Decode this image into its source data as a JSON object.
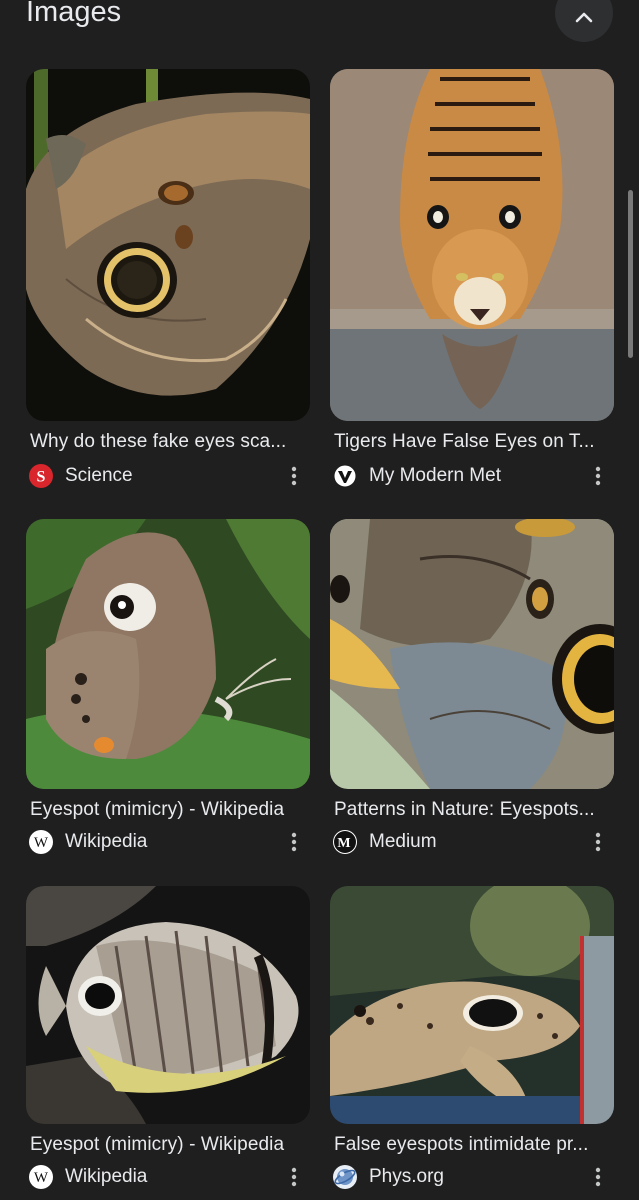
{
  "section": {
    "title": "Images",
    "collapse_icon": "chevron-up-icon"
  },
  "results": [
    {
      "title": "Why do these fake eyes sca...",
      "source": "Science",
      "favicon": "science-logo-icon",
      "image": "owl butterfly eyespot wing"
    },
    {
      "title": "Tigers Have False Eyes on T...",
      "source": "My Modern Met",
      "favicon": "my-modern-met-logo-icon",
      "image": "tiger drinking water"
    },
    {
      "title": "Eyespot (mimicry) - Wikipedia",
      "source": "Wikipedia",
      "favicon": "wikipedia-logo-icon",
      "image": "brown butterfly on leaf"
    },
    {
      "title": "Patterns in Nature: Eyespots...",
      "source": "Medium",
      "favicon": "medium-logo-icon",
      "image": "butterfly wing eyespot closeup"
    },
    {
      "title": "Eyespot (mimicry) - Wikipedia",
      "source": "Wikipedia",
      "favicon": "wikipedia-logo-icon",
      "image": "four-eye butterflyfish"
    },
    {
      "title": "False eyespots intimidate pr...",
      "source": "Phys.org",
      "favicon": "phys-org-logo-icon",
      "image": "epaulette shark with eyespot"
    }
  ],
  "colors": {
    "background": "#1f1f1f",
    "text": "#e8eaed",
    "science_red": "#d8262c"
  }
}
